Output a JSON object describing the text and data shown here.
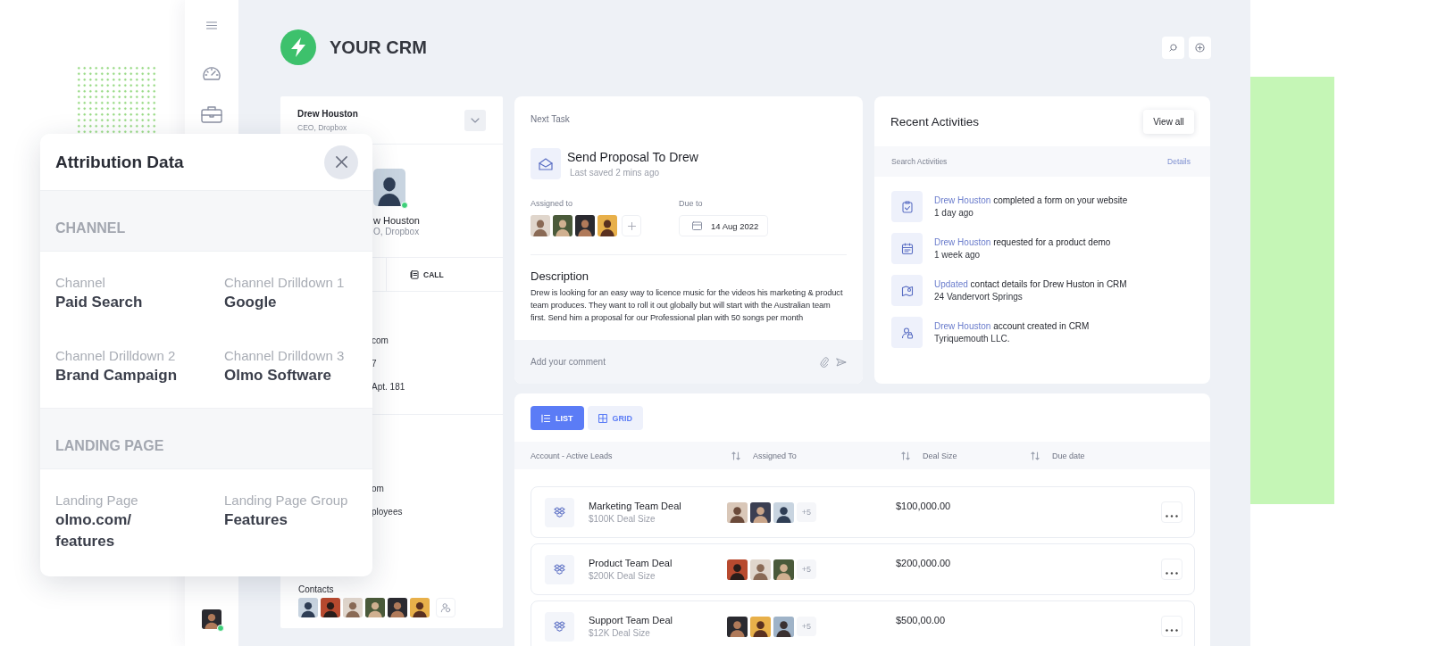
{
  "app": {
    "title": "YOUR CRM"
  },
  "user": {
    "online": true
  },
  "contact_card": {
    "name": "Drew Houston",
    "role": "CEO, Dropbox",
    "online": true,
    "profile_name": "w Houston",
    "profile_role": "O, Dropbox",
    "action": "CALL",
    "details": [
      "com",
      "7",
      "Apt. 181"
    ],
    "company_details": [
      "om",
      "ployees"
    ],
    "contacts_label": "Contacts"
  },
  "next_task": {
    "label": "Next Task",
    "title": "Send Proposal To Drew",
    "saved": "Last saved 2 mins ago",
    "assigned_label": "Assigned to",
    "due_label": "Due to",
    "due_date": "14 Aug 2022",
    "description_title": "Description",
    "description": "Drew is looking for an easy way to licence music for the videos his marketing & product team produces. They want to roll it out globally but will start with the Australian team first. Send him a proposal for our Professional plan with 50 songs per month",
    "comment_placeholder": "Add your comment"
  },
  "recent_activities": {
    "title": "Recent Activities",
    "view_all": "View all",
    "search_placeholder": "Search Activities",
    "details_link": "Details",
    "items": [
      {
        "link": "Drew Houston",
        "text": "completed a form on your website",
        "time": "1 day ago"
      },
      {
        "link": "Drew Houston",
        "text": "requested for a product demo",
        "time": "1 week ago"
      },
      {
        "link": "Updated",
        "text": "contact details for Drew Huston in CRM",
        "time": "24 Vandervort Springs"
      },
      {
        "link": "Drew Houston",
        "text": "account created in CRM",
        "time": "Tyriquemouth LLC."
      }
    ]
  },
  "leads": {
    "views": [
      {
        "label": "LIST",
        "selected": true
      },
      {
        "label": "GRID",
        "selected": false
      }
    ],
    "columns": [
      "Account - Active Leads",
      "Assigned To",
      "Deal Size",
      "Due date"
    ],
    "rows": [
      {
        "name": "Marketing Team Deal",
        "size": "$100K Deal Size",
        "more_assignees": "+5",
        "deal_size": "$100,000.00"
      },
      {
        "name": "Product Team Deal",
        "size": "$200K Deal Size",
        "more_assignees": "+5",
        "deal_size": "$200,000.00"
      },
      {
        "name": "Support Team Deal",
        "size": "$12K Deal Size",
        "more_assignees": "+5",
        "deal_size": "$500,00.00"
      }
    ]
  },
  "attribution": {
    "title": "Attribution Data",
    "sections": [
      {
        "heading": "CHANNEL",
        "fields": [
          {
            "label": "Channel",
            "value": "Paid Search"
          },
          {
            "label": "Channel Drilldown 1",
            "value": "Google"
          },
          {
            "label": "Channel Drilldown 2",
            "value": "Brand Campaign"
          },
          {
            "label": "Channel Drilldown 3",
            "value": "Olmo Software"
          }
        ]
      },
      {
        "heading": "LANDING PAGE",
        "fields": [
          {
            "label": "Landing Page",
            "value": "olmo.com/features"
          },
          {
            "label": "Landing Page Group",
            "value": "Features"
          }
        ]
      }
    ]
  }
}
